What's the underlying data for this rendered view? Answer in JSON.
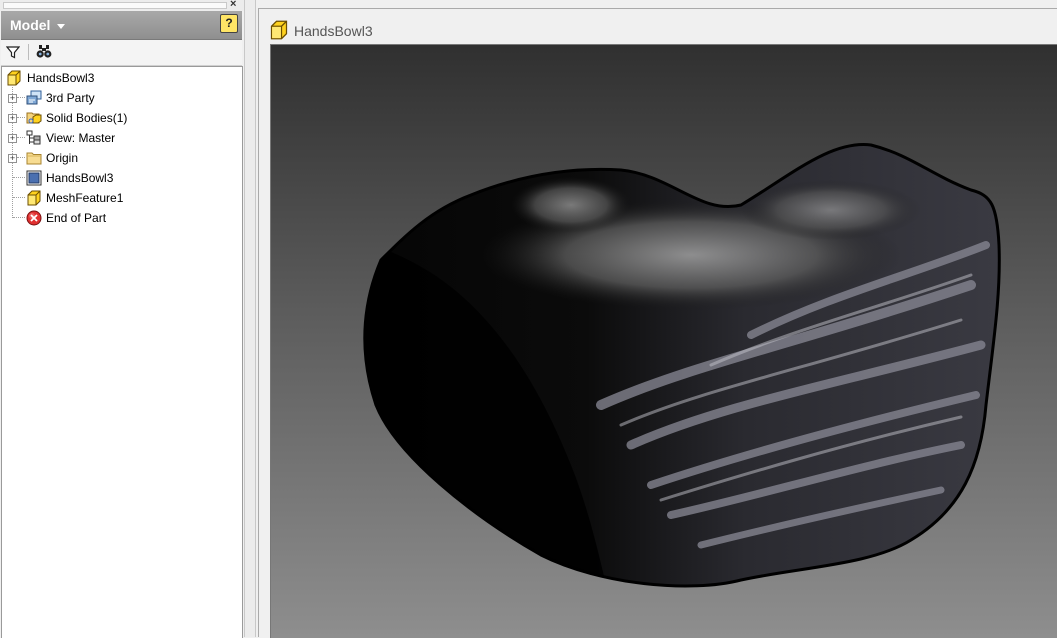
{
  "browser_panel": {
    "title": "Model",
    "help_glyph": "?",
    "close_glyph": "×",
    "toolbar": {
      "filter_icon": "filter-icon",
      "find_icon": "binoculars-icon"
    },
    "tree": {
      "root": {
        "label": "HandsBowl3",
        "icon": "part-cube-icon"
      },
      "items": [
        {
          "label": "3rd Party",
          "icon": "third-party-icon",
          "expandable": true
        },
        {
          "label": "Solid Bodies(1)",
          "icon": "solid-bodies-folder-icon",
          "expandable": true
        },
        {
          "label": "View: Master",
          "icon": "view-rep-icon",
          "expandable": true
        },
        {
          "label": "Origin",
          "icon": "folder-icon",
          "expandable": true
        },
        {
          "label": "HandsBowl3",
          "icon": "mesh-body-icon",
          "expandable": false
        },
        {
          "label": "MeshFeature1",
          "icon": "part-cube-icon",
          "expandable": false
        },
        {
          "label": "End of Part",
          "icon": "end-of-part-icon",
          "expandable": false
        }
      ]
    }
  },
  "document": {
    "tab_title": "HandsBowl3",
    "tab_icon": "part-cube-icon",
    "viewport_content": "3d-mesh-model"
  }
}
